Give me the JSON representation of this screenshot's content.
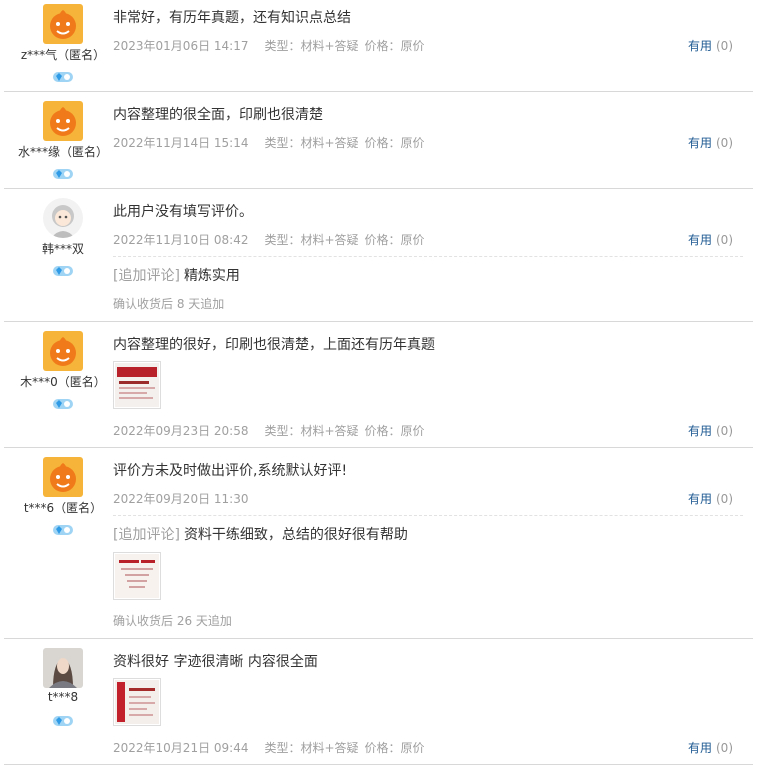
{
  "colors": {
    "link": "#1f5a92",
    "meta": "#a0a0a0",
    "text": "#333333",
    "divider": "#d8d8d8"
  },
  "reviews": [
    {
      "user": "z***气（匿名）",
      "avatar": "orange-cartoon-avatar",
      "content": "非常好，有历年真题，还有知识点总结",
      "date": "2023年01月06日 14:17",
      "type": "类型：材料+答疑",
      "price": "价格：原价",
      "useful_label": "有用",
      "useful_count": "(0)"
    },
    {
      "user": "水***缘（匿名）",
      "avatar": "orange-cartoon-avatar",
      "content": "内容整理的很全面，印刷也很清楚",
      "date": "2022年11月14日 15:14",
      "type": "类型：材料+答疑",
      "price": "价格：原价",
      "useful_label": "有用",
      "useful_count": "(0)"
    },
    {
      "user": "韩***双",
      "avatar": "default-gray-avatar",
      "content": "此用户没有填写评价。",
      "date": "2022年11月10日 08:42",
      "type": "类型：材料+答疑",
      "price": "价格：原价",
      "useful_label": "有用",
      "useful_count": "(0)",
      "append_tag": "[追加评论]",
      "append_text": "精炼实用",
      "confirm": "确认收货后 8 天追加"
    },
    {
      "user": "木***0（匿名）",
      "avatar": "orange-cartoon-avatar",
      "content": "内容整理的很好，印刷也很清楚，上面还有历年真题",
      "date": "2022年09月23日 20:58",
      "type": "类型：材料+答疑",
      "price": "价格：原价",
      "useful_label": "有用",
      "useful_count": "(0)"
    },
    {
      "user": "t***6（匿名）",
      "avatar": "orange-cartoon-avatar",
      "content": "评价方未及时做出评价,系统默认好评!",
      "date": "2022年09月20日 11:30",
      "useful_label": "有用",
      "useful_count": "(0)",
      "append_tag": "[追加评论]",
      "append_text": "资料干练细致，总结的很好很有帮助",
      "confirm": "确认收货后 26 天追加"
    },
    {
      "user": "t***8",
      "avatar": "photo-avatar",
      "content": "资料很好 字迹很清晰 内容很全面",
      "date": "2022年10月21日 09:44",
      "type": "类型：材料+答疑",
      "price": "价格：原价",
      "useful_label": "有用",
      "useful_count": "(0)"
    }
  ]
}
